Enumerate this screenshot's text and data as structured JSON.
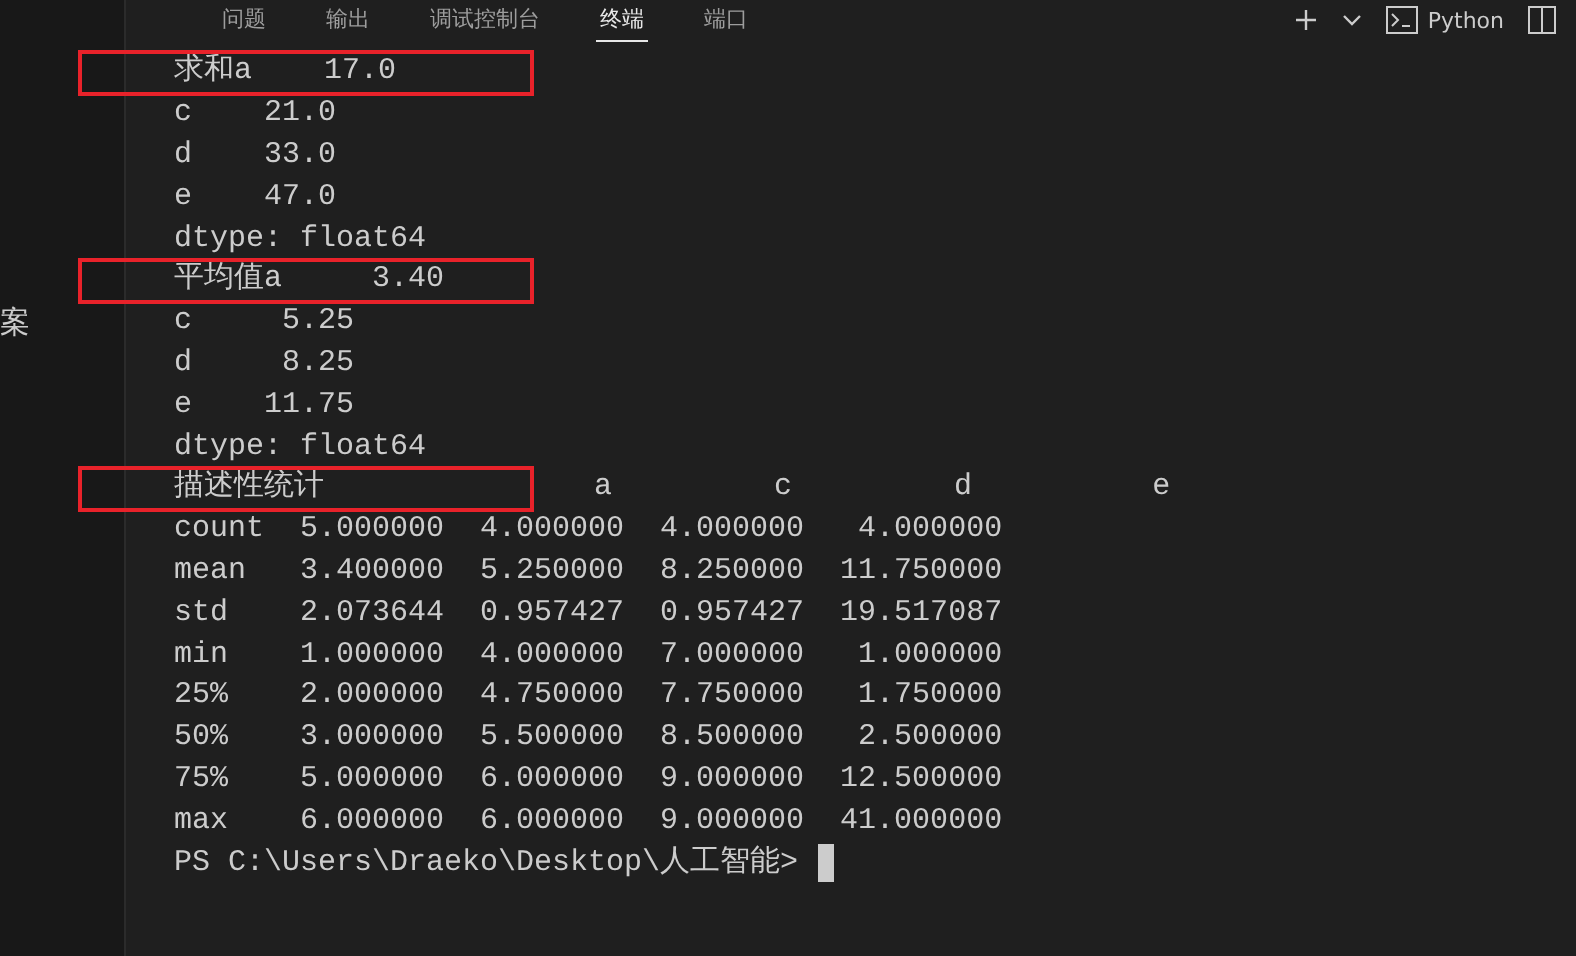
{
  "sidebar": {
    "text": "案"
  },
  "panel_tabs": [
    {
      "label": "问题",
      "selected": false
    },
    {
      "label": "输出",
      "selected": false
    },
    {
      "label": "调试控制台",
      "selected": false
    },
    {
      "label": "终端",
      "selected": true
    },
    {
      "label": "端口",
      "selected": false
    }
  ],
  "terminal_profile": {
    "label": "Python"
  },
  "terminal": {
    "lines": [
      {
        "text": "求和a    17.0",
        "highlighted": true
      },
      {
        "text": "c    21.0",
        "highlighted": false
      },
      {
        "text": "d    33.0",
        "highlighted": false
      },
      {
        "text": "e    47.0",
        "highlighted": false
      },
      {
        "text": "dtype: float64",
        "highlighted": false
      },
      {
        "text": "平均值a     3.40",
        "highlighted": true
      },
      {
        "text": "c     5.25",
        "highlighted": false
      },
      {
        "text": "d     8.25",
        "highlighted": false
      },
      {
        "text": "e    11.75",
        "highlighted": false
      },
      {
        "text": "dtype: float64",
        "highlighted": false
      },
      {
        "text": "描述性统计               a         c         d          e",
        "highlighted": true
      },
      {
        "text": "count  5.000000  4.000000  4.000000   4.000000",
        "highlighted": false
      },
      {
        "text": "mean   3.400000  5.250000  8.250000  11.750000",
        "highlighted": false
      },
      {
        "text": "std    2.073644  0.957427  0.957427  19.517087",
        "highlighted": false
      },
      {
        "text": "min    1.000000  4.000000  7.000000   1.000000",
        "highlighted": false
      },
      {
        "text": "25%    2.000000  4.750000  7.750000   1.750000",
        "highlighted": false
      },
      {
        "text": "50%    3.000000  5.500000  8.500000   2.500000",
        "highlighted": false
      },
      {
        "text": "75%    5.000000  6.000000  9.000000  12.500000",
        "highlighted": false
      },
      {
        "text": "max    6.000000  6.000000  9.000000  41.000000",
        "highlighted": false
      }
    ],
    "prompt": "PS C:\\Users\\Draeko\\Desktop\\人工智能>"
  }
}
